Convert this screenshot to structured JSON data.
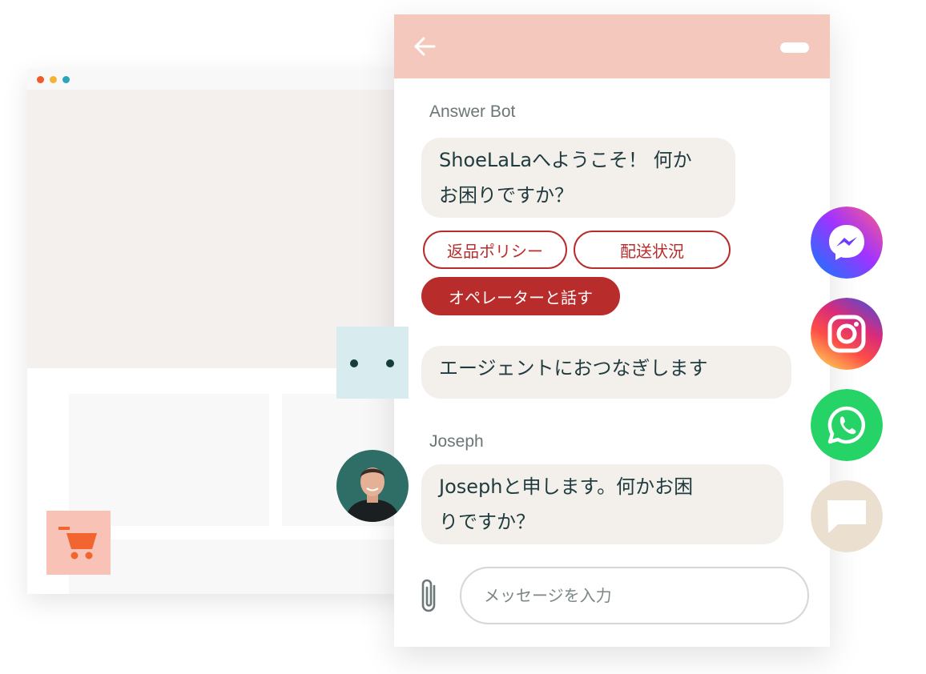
{
  "colors": {
    "header_bg": "#f5c8bd",
    "accent": "#b82c2c",
    "bubble_bg": "#f3efeb",
    "dot_red": "#f15a29",
    "dot_yellow": "#f5b335",
    "dot_blue": "#2aa6b8",
    "cart_orange": "#f26430",
    "whatsapp": "#25d366",
    "chat_channel": "#ebe0d0"
  },
  "icons": {
    "back": "arrow-left-icon",
    "minimize": "minimize-icon",
    "attach": "paperclip-icon",
    "cart": "shopping-cart-icon"
  },
  "chat": {
    "messages": [
      {
        "sender": "Answer Bot",
        "text": "ShoeLaLaへようこそ！ 何か\nお困りですか？"
      },
      {
        "text": "エージェントにおつなぎします"
      },
      {
        "sender": "Joseph",
        "text": "Josephと申します。何かお困\nりですか？"
      }
    ],
    "quick_replies": [
      "返品ポリシー",
      "配送状況",
      "オペレーターと話す"
    ],
    "input": {
      "placeholder": "メッセージを入力"
    }
  },
  "channels": [
    "messenger-icon",
    "instagram-icon",
    "whatsapp-icon",
    "chat-icon"
  ]
}
